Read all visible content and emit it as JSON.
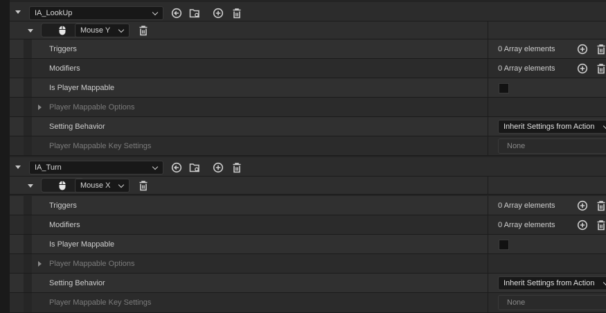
{
  "colors": {
    "background": "#242424",
    "text": "#cfcfcf",
    "dim_text": "#7c7c7c"
  },
  "mappings": [
    {
      "action": "IA_LookUp",
      "key": "Mouse Y",
      "triggers": {
        "label": "Triggers",
        "value": "0 Array elements"
      },
      "modifiers": {
        "label": "Modifiers",
        "value": "0 Array elements"
      },
      "is_player_mappable": {
        "label": "Is Player Mappable",
        "checked": false
      },
      "player_mappable_options": {
        "label": "Player Mappable Options"
      },
      "setting_behavior": {
        "label": "Setting Behavior",
        "value": "Inherit Settings from Action"
      },
      "key_settings": {
        "label": "Player Mappable Key Settings",
        "value": "None"
      }
    },
    {
      "action": "IA_Turn",
      "key": "Mouse X",
      "triggers": {
        "label": "Triggers",
        "value": "0 Array elements"
      },
      "modifiers": {
        "label": "Modifiers",
        "value": "0 Array elements"
      },
      "is_player_mappable": {
        "label": "Is Player Mappable",
        "checked": false
      },
      "player_mappable_options": {
        "label": "Player Mappable Options"
      },
      "setting_behavior": {
        "label": "Setting Behavior",
        "value": "Inherit Settings from Action"
      },
      "key_settings": {
        "label": "Player Mappable Key Settings",
        "value": "None"
      }
    }
  ],
  "icons": [
    "expand-triangle-icon",
    "use-selected-icon",
    "browse-folder-icon",
    "add-icon",
    "delete-icon",
    "mouse-icon",
    "chevron-down-icon"
  ]
}
